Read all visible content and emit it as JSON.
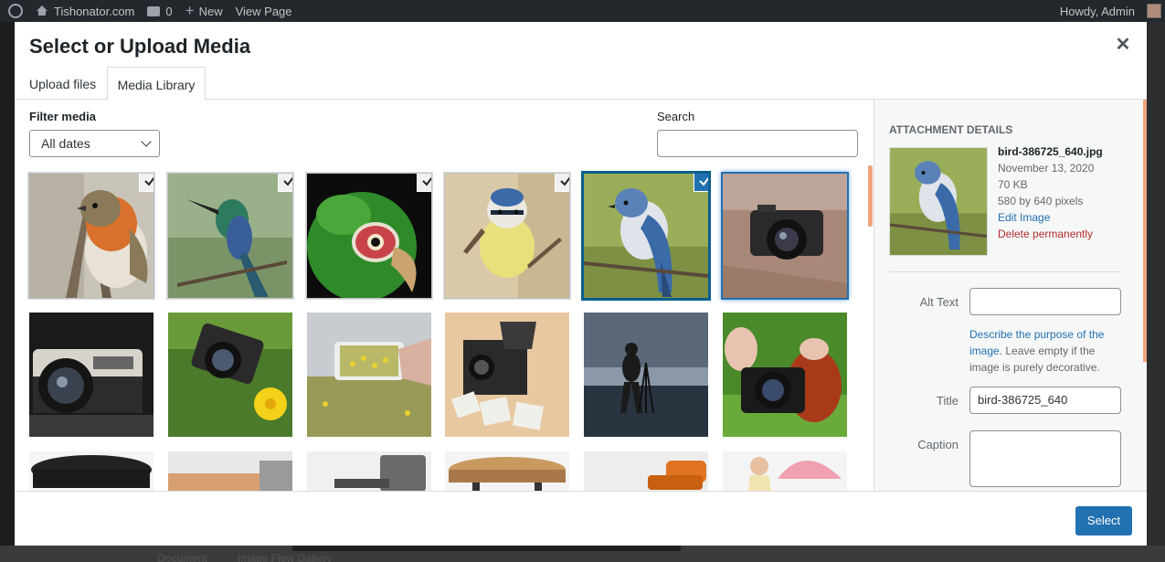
{
  "adminbar": {
    "site_name": "Tishonator.com",
    "comments_count": "0",
    "new_label": "New",
    "view_page_label": "View Page",
    "greeting": "Howdy, Admin"
  },
  "background": {
    "bottom_left_text": "Document",
    "bottom_mid_text": "Image Flow Gallery"
  },
  "modal": {
    "title": "Select or Upload Media",
    "close_icon": "close-icon"
  },
  "tabs": [
    {
      "label": "Upload files",
      "active": false
    },
    {
      "label": "Media Library",
      "active": true
    }
  ],
  "filter": {
    "label": "Filter media",
    "selected": "All dates"
  },
  "search": {
    "label": "Search",
    "value": ""
  },
  "attachment_details": {
    "heading": "Attachment Details",
    "filename": "bird-386725_640.jpg",
    "date": "November 13, 2020",
    "size": "70 KB",
    "dimensions": "580 by 640 pixels",
    "edit_link": "Edit Image",
    "delete_link": "Delete permanently",
    "alt_text_label": "Alt Text",
    "alt_text_value": "",
    "help_link": "Describe the purpose of the image",
    "help_rest": ". Leave empty if the image is purely decorative.",
    "title_label": "Title",
    "title_value": "bird-386725_640",
    "caption_label": "Caption",
    "caption_value": ""
  },
  "footer": {
    "select_label": "Select"
  },
  "colors": {
    "accent": "#2271b1",
    "delete": "#b32d2e",
    "adminbar": "#23282d"
  }
}
